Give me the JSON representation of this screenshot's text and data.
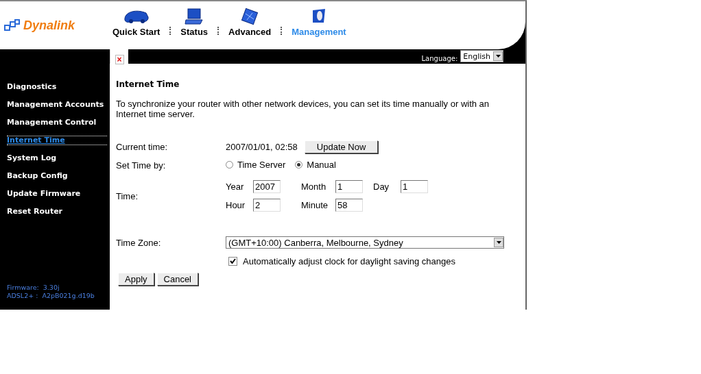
{
  "logo": "Dynalink",
  "nav": [
    {
      "label": "Quick Start",
      "kind": "car",
      "selected": false
    },
    {
      "label": "Status",
      "kind": "laptop",
      "selected": false
    },
    {
      "label": "Advanced",
      "kind": "chip",
      "selected": false
    },
    {
      "label": "Management",
      "kind": "mouse",
      "selected": true
    }
  ],
  "close": "×",
  "language": {
    "label": "Language:",
    "value": "English"
  },
  "sidebar": {
    "items": [
      {
        "label": "Diagnostics",
        "selected": false
      },
      {
        "label": "Management Accounts",
        "selected": false
      },
      {
        "label": "Management Control",
        "selected": false
      },
      {
        "label": "Internet Time",
        "selected": true
      },
      {
        "label": "System Log",
        "selected": false
      },
      {
        "label": "Backup Config",
        "selected": false
      },
      {
        "label": "Update Firmware",
        "selected": false
      },
      {
        "label": "Reset Router",
        "selected": false
      }
    ],
    "firmware": [
      "Firmware:  3.30j",
      "ADSL2+ :  A2pB021g.d19b"
    ]
  },
  "content": {
    "title": "Internet Time",
    "description": "To synchronize your router with other network devices, you can set its time manually or with an Internet time server.",
    "current_time": {
      "label": "Current time:",
      "value": "2007/01/01, 02:58",
      "button": "Update Now"
    },
    "set_time_by": {
      "label": "Set Time by:",
      "options": [
        {
          "label": "Time Server",
          "selected": false
        },
        {
          "label": "Manual",
          "selected": true
        }
      ]
    },
    "time": {
      "label": "Time:",
      "fields": [
        [
          {
            "label": "Year",
            "value": "2007"
          },
          {
            "label": "Month",
            "value": "1"
          },
          {
            "label": "Day",
            "value": "1"
          }
        ],
        [
          {
            "label": "Hour",
            "value": "2"
          },
          {
            "label": "Minute",
            "value": "58"
          }
        ]
      ]
    },
    "time_zone": {
      "label": "Time Zone:",
      "value": "(GMT+10:00) Canberra, Melbourne, Sydney"
    },
    "daylight": {
      "label": "Automatically adjust clock for daylight saving changes",
      "checked": true
    },
    "buttons": [
      "Apply",
      "Cancel"
    ]
  }
}
